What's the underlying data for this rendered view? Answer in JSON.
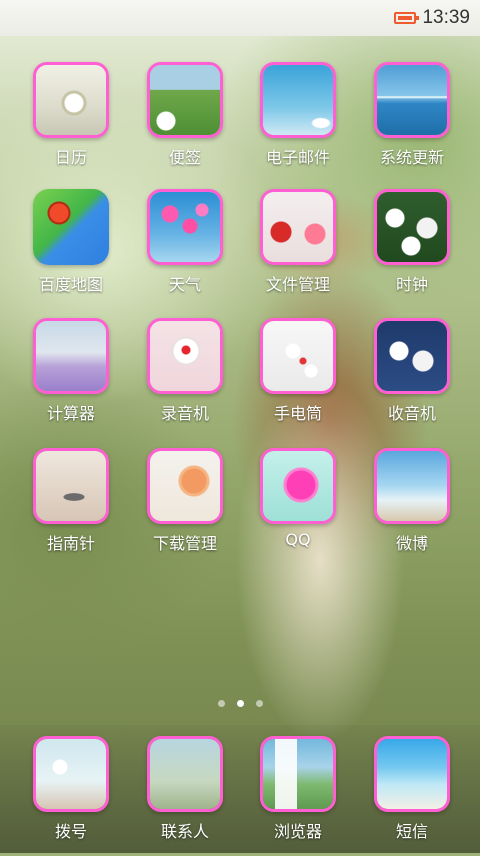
{
  "status_bar": {
    "time": "13:39",
    "battery_color": "#ef5b2f"
  },
  "page_indicator": {
    "pages": 3,
    "active": 2
  },
  "apps": [
    {
      "label": "日历",
      "icon": "calendar-icon"
    },
    {
      "label": "便签",
      "icon": "notes-icon"
    },
    {
      "label": "电子邮件",
      "icon": "email-icon"
    },
    {
      "label": "系统更新",
      "icon": "system-update-icon"
    },
    {
      "label": "百度地图",
      "icon": "baidu-map-icon"
    },
    {
      "label": "天气",
      "icon": "weather-icon"
    },
    {
      "label": "文件管理",
      "icon": "file-manager-icon"
    },
    {
      "label": "时钟",
      "icon": "clock-icon"
    },
    {
      "label": "计算器",
      "icon": "calculator-icon"
    },
    {
      "label": "录音机",
      "icon": "recorder-icon"
    },
    {
      "label": "手电筒",
      "icon": "flashlight-icon"
    },
    {
      "label": "收音机",
      "icon": "radio-icon"
    },
    {
      "label": "指南针",
      "icon": "compass-icon"
    },
    {
      "label": "下载管理",
      "icon": "download-manager-icon"
    },
    {
      "label": "QQ",
      "icon": "qq-icon"
    },
    {
      "label": "微博",
      "icon": "weibo-icon"
    }
  ],
  "dock": [
    {
      "label": "拨号",
      "icon": "dialer-icon"
    },
    {
      "label": "联系人",
      "icon": "contacts-icon"
    },
    {
      "label": "浏览器",
      "icon": "browser-icon"
    },
    {
      "label": "短信",
      "icon": "sms-icon"
    }
  ],
  "colors": {
    "icon_border": "#ff5fd2",
    "label_text": "#ffffff"
  }
}
